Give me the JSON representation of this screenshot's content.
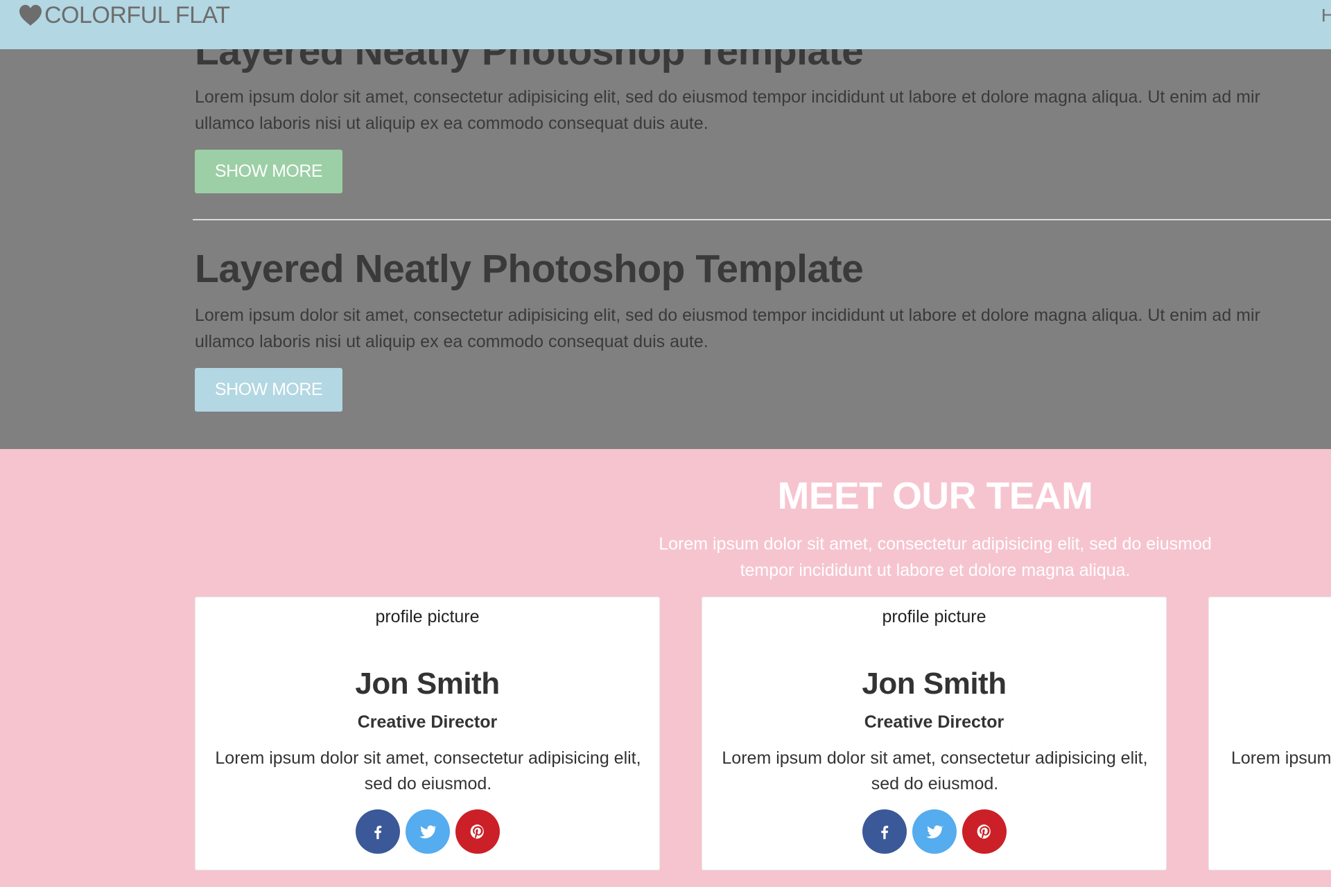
{
  "header": {
    "brand": "COLORFUL FLAT",
    "brand_icon": "heart-icon",
    "nav_clipped_text": "H"
  },
  "posts": [
    {
      "title": "Layered Neatly Photoshop Template",
      "body_line1": "Lorem ipsum dolor sit amet, consectetur adipisicing elit, sed do eiusmod tempor incididunt ut labore et dolore magna aliqua. Ut enim ad mir",
      "body_line2": "ullamco laboris nisi ut aliquip ex ea commodo consequat duis aute.",
      "button": "SHOW MORE",
      "button_color": "#9ccfa5"
    },
    {
      "title": "Layered Neatly Photoshop Template",
      "body_line1": "Lorem ipsum dolor sit amet, consectetur adipisicing elit, sed do eiusmod tempor incididunt ut labore et dolore magna aliqua. Ut enim ad mir",
      "body_line2": "ullamco laboris nisi ut aliquip ex ea commodo consequat duis aute.",
      "button": "SHOW MORE",
      "button_color": "#b3d7e3"
    }
  ],
  "team": {
    "title": "MEET OUR TEAM",
    "subtitle": "Lorem ipsum dolor sit amet, consectetur adipisicing elit, sed do eiusmod tempor incididunt ut labore et dolore magna aliqua.",
    "members": [
      {
        "picture": "profile picture",
        "name": "Jon Smith",
        "role": "Creative Director",
        "bio": "Lorem ipsum dolor sit amet, consectetur adipisicing elit, sed do eiusmod."
      },
      {
        "picture": "profile picture",
        "name": "Jon Smith",
        "role": "Creative Director",
        "bio": "Lorem ipsum dolor sit amet, consectetur adipisicing elit, sed do eiusmod."
      },
      {
        "bio_clipped": "Lorem ipsum"
      }
    ],
    "social_icons": [
      "facebook-icon",
      "twitter-icon",
      "pinterest-icon"
    ]
  },
  "colors": {
    "header_bg": "#b3d7e3",
    "dark_bg": "#808080",
    "team_bg": "#f6c4cf",
    "facebook": "#3b5998",
    "twitter": "#55acee",
    "pinterest": "#cb2027"
  }
}
